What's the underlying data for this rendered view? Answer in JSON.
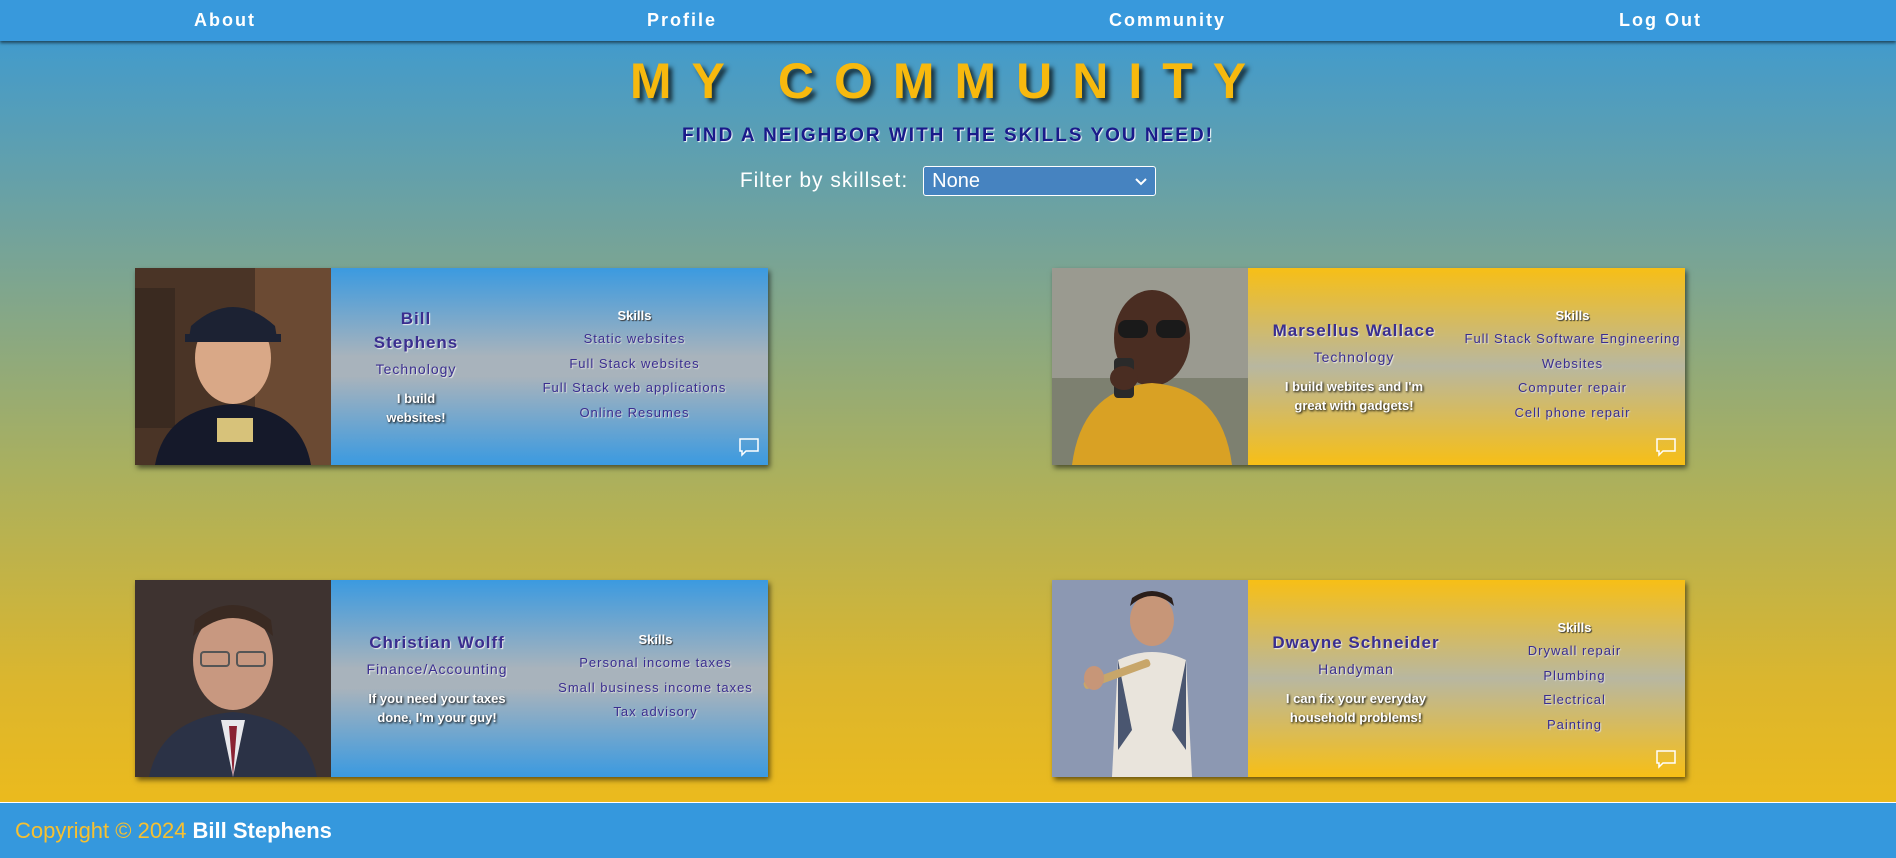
{
  "nav": {
    "items": [
      {
        "label": "About"
      },
      {
        "label": "Profile"
      },
      {
        "label": "Community"
      },
      {
        "label": "Log Out"
      }
    ]
  },
  "header": {
    "title": "MY COMMUNITY",
    "subtitle": "FIND A NEIGHBOR WITH THE SKILLS YOU NEED!"
  },
  "filter": {
    "label": "Filter by skillset:",
    "selected": "None"
  },
  "members": [
    {
      "name_line1": "Bill",
      "name_line2": "Stephens",
      "field": "Technology",
      "bio": "I build websites!",
      "skills_title": "Skills",
      "skills": [
        "Static websites",
        "Full Stack websites",
        "Full Stack web applications",
        "Online Resumes"
      ]
    },
    {
      "name": "Marsellus Wallace",
      "field": "Technology",
      "bio": "I build webites and I'm great with gadgets!",
      "skills_title": "Skills",
      "skills": [
        "Full Stack Software Engineering",
        "Websites",
        "Computer repair",
        "Cell phone repair"
      ]
    },
    {
      "name": "Christian Wolff",
      "field": "Finance/Accounting",
      "bio": "If you need your taxes done, I'm your guy!",
      "skills_title": "Skills",
      "skills": [
        "Personal income taxes",
        "Small business income taxes",
        "Tax advisory"
      ]
    },
    {
      "name": "Dwayne Schneider",
      "field": "Handyman",
      "bio": "I can fix your everyday household problems!",
      "skills_title": "Skills",
      "skills": [
        "Drywall repair",
        "Plumbing",
        "Electrical",
        "Painting"
      ]
    }
  ],
  "footer": {
    "copyright": "Copyright © 2024",
    "author": "Bill Stephens"
  },
  "colors": {
    "nav_bg": "#3899dc",
    "title_gold": "#f7b90e",
    "card_blue": "#3b9ae0",
    "card_gold": "#f7bf16",
    "name_purple": "#3a2e8f"
  }
}
